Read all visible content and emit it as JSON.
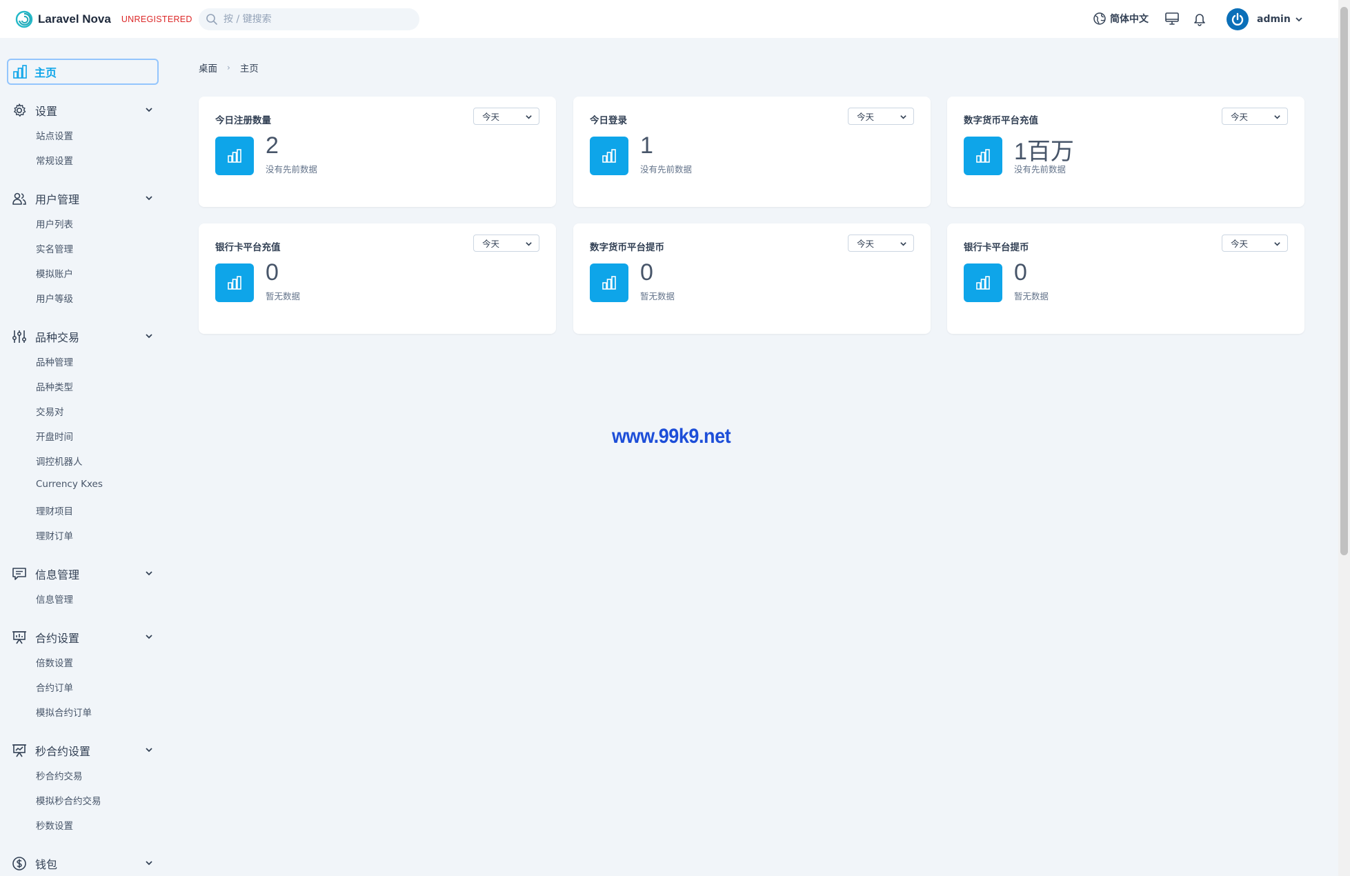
{
  "header": {
    "app_name": "Laravel Nova",
    "unregistered": "UNREGISTERED",
    "search_placeholder": "按 / 键搜索",
    "language": "简体中文",
    "user_name": "admin"
  },
  "sidebar": {
    "home": "主页",
    "groups": [
      {
        "label": "设置",
        "icon": "gear-icon",
        "items": [
          "站点设置",
          "常规设置"
        ]
      },
      {
        "label": "用户管理",
        "icon": "users-icon",
        "items": [
          "用户列表",
          "实名管理",
          "模拟账户",
          "用户等级"
        ]
      },
      {
        "label": "品种交易",
        "icon": "sliders-icon",
        "items": [
          "品种管理",
          "品种类型",
          "交易对",
          "开盘时间",
          "调控机器人",
          "Currency Kxes",
          "理财项目",
          "理财订单"
        ]
      },
      {
        "label": "信息管理",
        "icon": "chat-icon",
        "items": [
          "信息管理"
        ]
      },
      {
        "label": "合约设置",
        "icon": "presentation-chart-icon",
        "items": [
          "倍数设置",
          "合约订单",
          "模拟合约订单"
        ]
      },
      {
        "label": "秒合约设置",
        "icon": "trend-chart-icon",
        "items": [
          "秒合约交易",
          "模拟秒合约交易",
          "秒数设置"
        ]
      },
      {
        "label": "钱包",
        "icon": "dollar-icon",
        "items": []
      }
    ]
  },
  "breadcrumb": {
    "root": "桌面",
    "current": "主页"
  },
  "cards": [
    {
      "title": "今日注册数量",
      "range": "今天",
      "value": "2",
      "sub": "没有先前数据"
    },
    {
      "title": "今日登录",
      "range": "今天",
      "value": "1",
      "sub": "没有先前数据"
    },
    {
      "title": "数字货币平台充值",
      "range": "今天",
      "value": "1百万",
      "sub": "没有先前数据"
    },
    {
      "title": "银行卡平台充值",
      "range": "今天",
      "value": "0",
      "sub": "暂无数据"
    },
    {
      "title": "数字货币平台提币",
      "range": "今天",
      "value": "0",
      "sub": "暂无数据"
    },
    {
      "title": "银行卡平台提币",
      "range": "今天",
      "value": "0",
      "sub": "暂无数据"
    }
  ],
  "watermark": "www.99k9.net",
  "colors": {
    "accent": "#0ea5e9",
    "brand": "#1e293b",
    "unregistered": "#dc2626",
    "watermark": "#1d4ed8"
  }
}
